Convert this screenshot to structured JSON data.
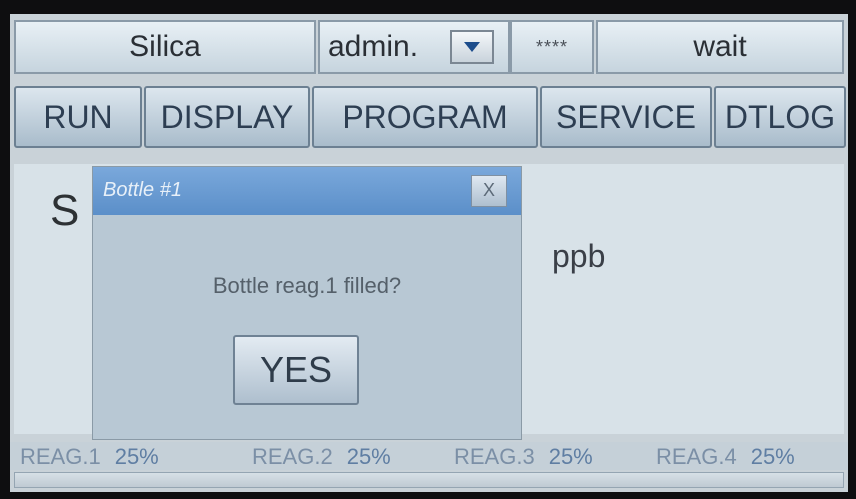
{
  "header": {
    "title": "Silica",
    "user": "admin.",
    "password_mask": "****",
    "status": "wait"
  },
  "tabs": [
    {
      "label": "RUN"
    },
    {
      "label": "DISPLAY"
    },
    {
      "label": "PROGRAM"
    },
    {
      "label": "SERVICE"
    },
    {
      "label": "DTLOG"
    }
  ],
  "main": {
    "measurement_letter": "S",
    "unit": "ppb"
  },
  "dialog": {
    "title": "Bottle #1",
    "close_label": "X",
    "message": "Bottle reag.1 filled?",
    "confirm_label": "YES"
  },
  "reagents": [
    {
      "label": "REAG.1",
      "value": "25%"
    },
    {
      "label": "REAG.2",
      "value": "25%"
    },
    {
      "label": "REAG.3",
      "value": "25%"
    },
    {
      "label": "REAG.4",
      "value": "25%"
    }
  ],
  "icons": {
    "user_dropdown": "chevron-down-icon"
  },
  "colors": {
    "dialog_title_bar": "#6a9bd2",
    "tab_text": "#2d3e52",
    "reagent_text": "#7b8fa6"
  }
}
